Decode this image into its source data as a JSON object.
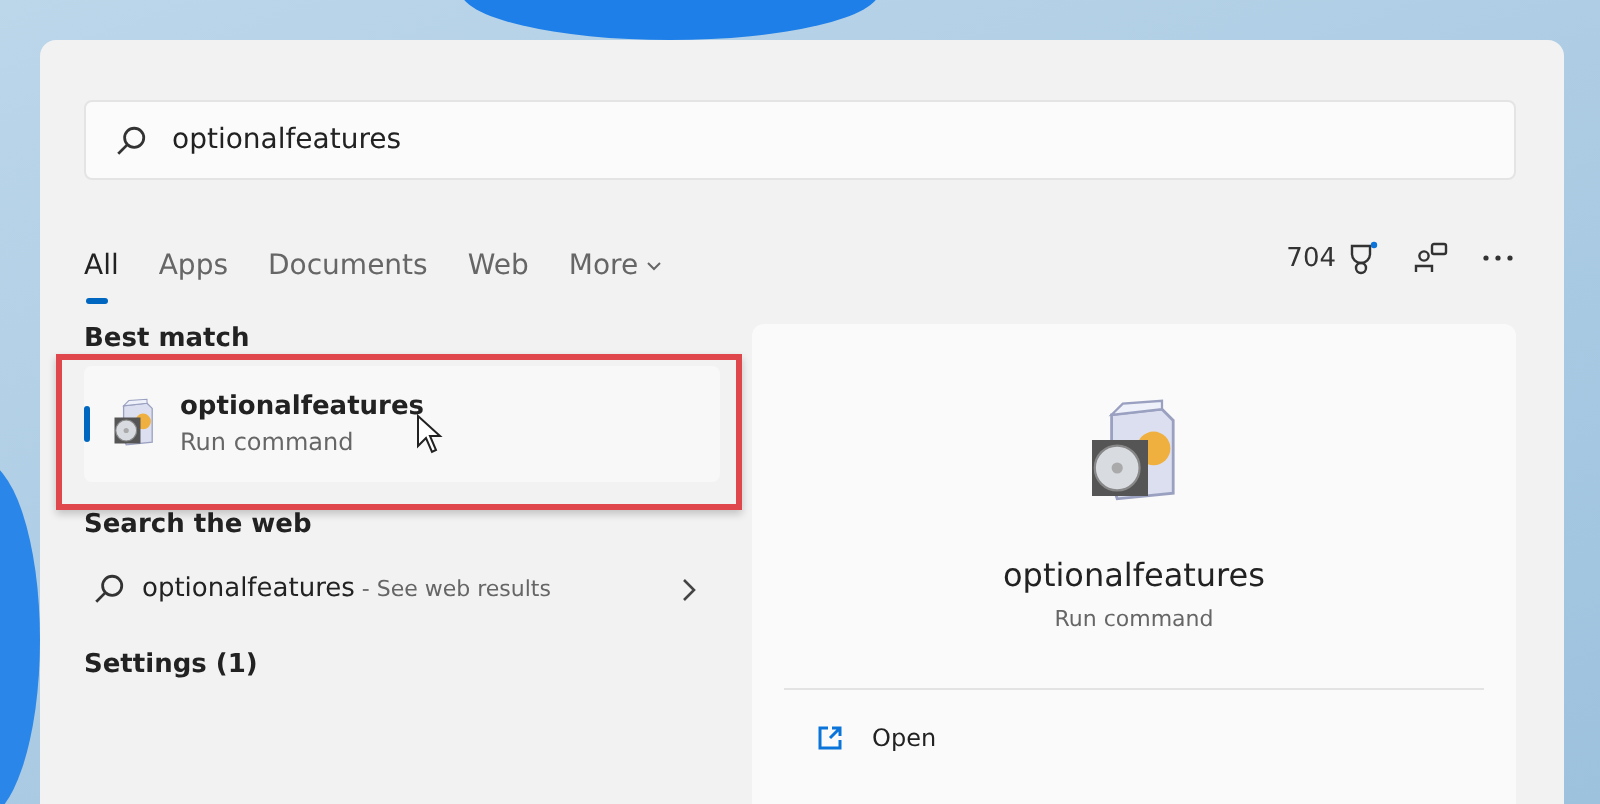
{
  "search": {
    "value": "optionalfeatures"
  },
  "tabs": [
    {
      "label": "All",
      "selected": true
    },
    {
      "label": "Apps",
      "selected": false
    },
    {
      "label": "Documents",
      "selected": false
    },
    {
      "label": "Web",
      "selected": false
    },
    {
      "label": "More",
      "selected": false
    }
  ],
  "toolbar": {
    "points": "704"
  },
  "best_match": {
    "heading": "Best match",
    "title": "optionalfeatures",
    "subtitle": "Run command",
    "selected": true
  },
  "web_search": {
    "heading": "Search the web",
    "query": "optionalfeatures",
    "hint": " - See web results"
  },
  "settings": {
    "heading": "Settings (1)"
  },
  "preview": {
    "title": "optionalfeatures",
    "subtitle": "Run command",
    "actions": [
      {
        "label": "Open"
      }
    ]
  }
}
